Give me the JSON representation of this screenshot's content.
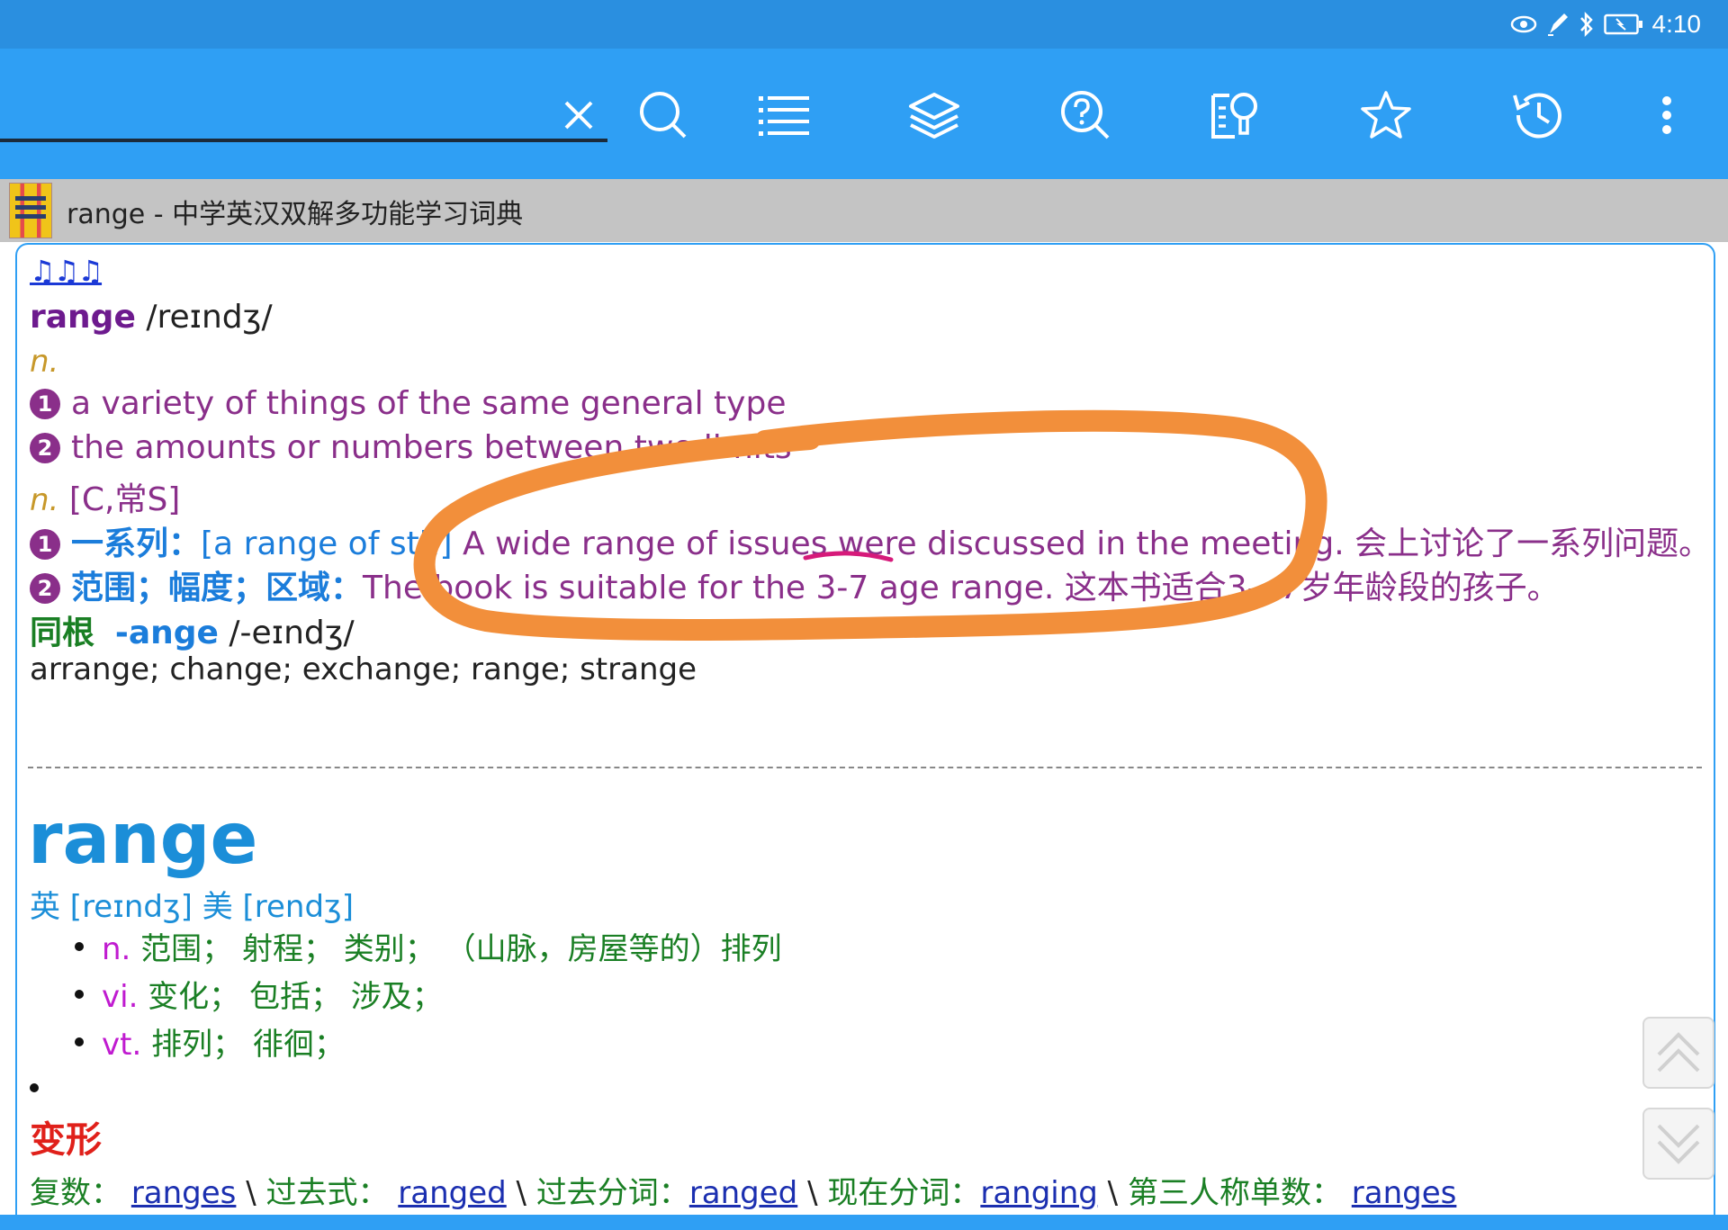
{
  "status": {
    "time": "4:10"
  },
  "search": {
    "value": "",
    "placeholder": ""
  },
  "dict_header": {
    "title": "range - 中学英汉双解多功能学习词典"
  },
  "entry1": {
    "audio_icon": "♫♫♫",
    "headword": "range",
    "pron": "/reɪndʒ/",
    "pos1": "n.",
    "def1_num": "1",
    "def1": "a variety of things of the same general type",
    "def2_num": "2",
    "def2": "the amounts or numbers between two limits",
    "pos2": "n.",
    "pos2_extra": "[C,常S]",
    "sense1_num": "1",
    "sense1_zh": "一系列：",
    "sense1_phrase": "[a range of sth]",
    "sense1_example": " A wide range of issues were discussed in the meeting. 会上讨论了一系列问题。",
    "sense2_num": "2",
    "sense2_zh": "范围；幅度；区域：",
    "sense2_example": "The book is suitable for the 3-7 age range. 这本书适合3—7岁年龄段的孩子。",
    "root_label": "同根",
    "root_suffix": "-ange",
    "root_pron": "/-eɪndʒ/",
    "root_words": "arrange; change; exchange; range; strange"
  },
  "entry2": {
    "word": "range",
    "pron": "英 [reɪndʒ] 美 [rendʒ]",
    "meanings": [
      {
        "pos": "n.",
        "text": " 范围； 射程； 类别； （山脉，房屋等的）排列"
      },
      {
        "pos": "vi.",
        "text": " 变化； 包括； 涉及；"
      },
      {
        "pos": "vt.",
        "text": " 排列； 徘徊；"
      }
    ],
    "forms_title": "变形",
    "forms": [
      {
        "label": "复数：",
        "value": "ranges"
      },
      {
        "label": "过去式：",
        "value": "ranged"
      },
      {
        "label": "过去分词：",
        "value": "ranged"
      },
      {
        "label": "现在分词：",
        "value": "ranging"
      },
      {
        "label": "第三人称单数：",
        "value": "ranges"
      }
    ],
    "sep": " \\ "
  },
  "colors": {
    "accent": "#2f9ff4",
    "status": "#2a8fe0",
    "annotation": "#f28f3b",
    "underline": "#d61a7a"
  }
}
